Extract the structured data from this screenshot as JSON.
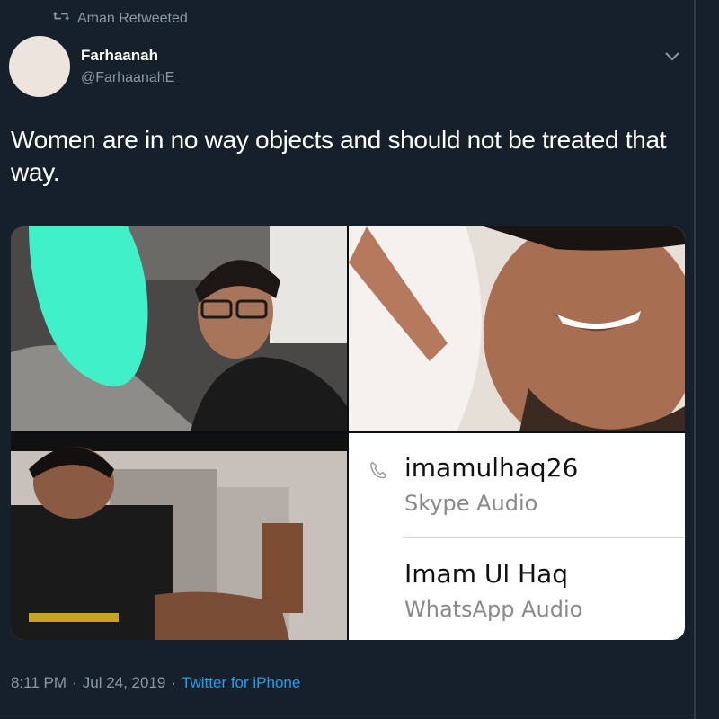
{
  "retweet": {
    "label": "Aman Retweeted"
  },
  "author": {
    "name": "Farhaanah",
    "handle": "@FarhaanahE"
  },
  "tweet": {
    "text": "Women are in no way objects and should not be treated that way."
  },
  "media": {
    "calls": [
      {
        "name": "imamulhaq26",
        "type": "Skype Audio"
      },
      {
        "name": "Imam Ul Haq",
        "type": "WhatsApp Audio"
      }
    ]
  },
  "meta": {
    "time": "8:11 PM",
    "date": "Jul 24, 2019",
    "separator": "·",
    "source": "Twitter for iPhone"
  },
  "colors": {
    "background": "#15202b",
    "secondary_text": "#8899a6",
    "link": "#1da1f2",
    "censor_mark": "#3ff0c8"
  },
  "icons": {
    "retweet": "retweet-icon",
    "menu": "chevron-down-icon",
    "call": "phone-icon"
  }
}
